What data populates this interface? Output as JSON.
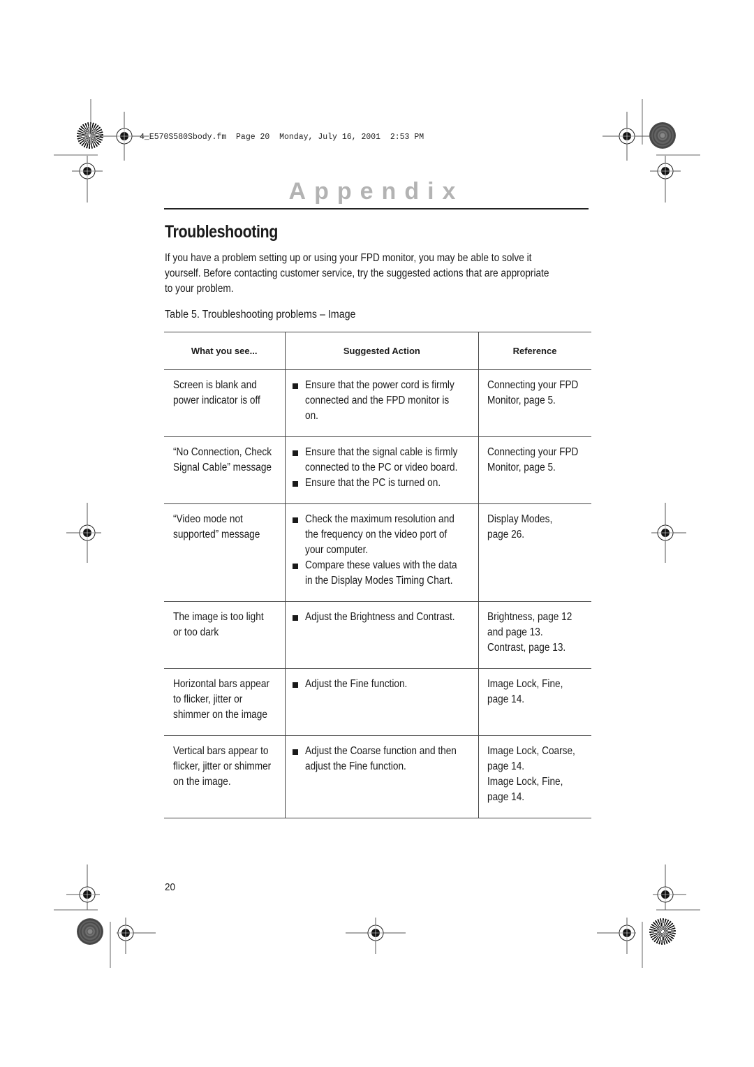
{
  "print_header": "4_E570S580Sbody.fm  Page 20  Monday, July 16, 2001  2:53 PM",
  "section_header": "Appendix",
  "title": "Troubleshooting",
  "intro_lines": [
    "If you have a problem setting up or using your FPD monitor, you may be able to solve it",
    "yourself. Before contacting customer service, try the suggested actions that are appropriate",
    "to your problem."
  ],
  "table": {
    "caption": "Table 5.  Troubleshooting problems – Image",
    "headers": [
      "What you see...",
      "Suggested Action",
      "Reference"
    ],
    "rows": [
      {
        "symptom": [
          "Screen is blank and",
          "power indicator is off"
        ],
        "actions": [
          [
            "Ensure that the power cord is firmly",
            "connected and the FPD monitor is",
            "on."
          ]
        ],
        "reference": [
          "Connecting your FPD",
          "Monitor, page 5."
        ]
      },
      {
        "symptom": [
          "“No Connection, Check",
          "Signal Cable” message"
        ],
        "actions": [
          [
            "Ensure that the signal cable is firmly",
            "connected to the PC or video board."
          ],
          [
            "Ensure that the PC is turned on."
          ]
        ],
        "reference": [
          "Connecting your FPD",
          "Monitor, page 5."
        ]
      },
      {
        "symptom": [
          "“Video mode not",
          "supported” message"
        ],
        "actions": [
          [
            "Check the maximum resolution and",
            "the frequency on the video port of",
            "your computer."
          ],
          [
            "Compare these values with the data",
            "in the Display Modes Timing Chart."
          ]
        ],
        "reference": [
          "Display Modes,",
          "page 26."
        ]
      },
      {
        "symptom": [
          "The image is too light",
          "or too dark"
        ],
        "actions": [
          [
            "Adjust the Brightness and Contrast."
          ]
        ],
        "reference": [
          "Brightness, page 12",
          "and page 13.",
          "Contrast, page 13."
        ]
      },
      {
        "symptom": [
          "Horizontal bars appear",
          "to flicker, jitter or",
          "shimmer on the image"
        ],
        "actions": [
          [
            "Adjust the Fine function."
          ]
        ],
        "reference": [
          "Image Lock, Fine,",
          "page 14."
        ]
      },
      {
        "symptom": [
          "Vertical bars appear to",
          "flicker, jitter or shimmer",
          "on the image."
        ],
        "actions": [
          [
            "Adjust the Coarse function and then",
            "adjust the Fine function."
          ]
        ],
        "reference": [
          "Image Lock, Coarse,",
          "page 14.",
          "Image Lock, Fine,",
          "page 14."
        ]
      }
    ]
  },
  "page_number": "20"
}
